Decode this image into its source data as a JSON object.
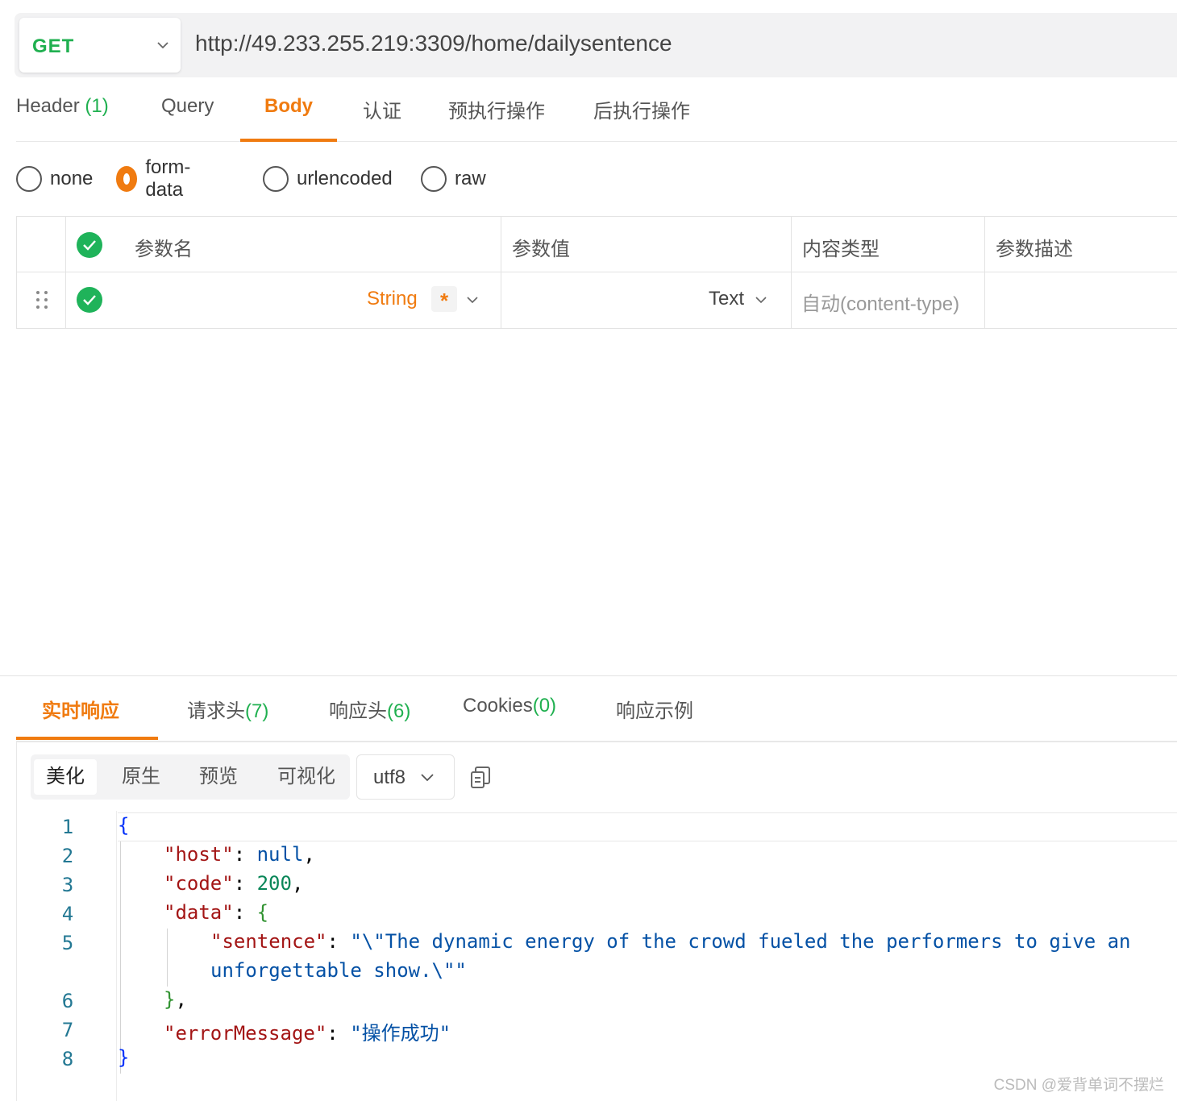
{
  "request": {
    "method": "GET",
    "url": "http://49.233.255.219:3309/home/dailysentence"
  },
  "request_tabs": [
    {
      "label": "Header",
      "count": "(1)"
    },
    {
      "label": "Query"
    },
    {
      "label": "Body",
      "active": true
    },
    {
      "label": "认证"
    },
    {
      "label": "预执行操作"
    },
    {
      "label": "后执行操作"
    }
  ],
  "body_types": [
    {
      "label": "none",
      "checked": false
    },
    {
      "label": "form-data",
      "checked": true
    },
    {
      "label": "urlencoded",
      "checked": false
    },
    {
      "label": "raw",
      "checked": false
    }
  ],
  "params_table": {
    "headers": [
      "参数名",
      "参数值",
      "内容类型",
      "参数描述"
    ],
    "row": {
      "type": "String",
      "required_mark": "*",
      "value_type": "Text",
      "content_type": "自动(content-type)"
    }
  },
  "response_tabs": [
    {
      "label": "实时响应",
      "active": true
    },
    {
      "label": "请求头",
      "count": "(7)"
    },
    {
      "label": "响应头",
      "count": "(6)"
    },
    {
      "label": "Cookies",
      "count": "(0)"
    },
    {
      "label": "响应示例"
    }
  ],
  "view_modes": [
    "美化",
    "原生",
    "预览",
    "可视化"
  ],
  "active_view_mode": "美化",
  "encoding": "utf8",
  "code": {
    "line_numbers": [
      "1",
      "2",
      "3",
      "4",
      "5",
      "6",
      "7",
      "8"
    ],
    "open_brace": "{",
    "host_key": "\"host\"",
    "host_value": "null",
    "code_key": "\"code\"",
    "code_value": "200",
    "data_key": "\"data\"",
    "data_open": "{",
    "sentence_key": "\"sentence\"",
    "sentence_value_line1": "\"\\\"The dynamic energy of the crowd fueled the performers to give an",
    "sentence_value_line2": "unforgettable show.\\\"\"",
    "data_close": "}",
    "error_key": "\"errorMessage\"",
    "error_value": "\"操作成功\"",
    "close_brace": "}"
  },
  "colors": {
    "accent": "#f07b10",
    "method_green": "#20b050",
    "check_green": "#1fb35a"
  },
  "watermark": "CSDN @爱背单词不摆烂"
}
